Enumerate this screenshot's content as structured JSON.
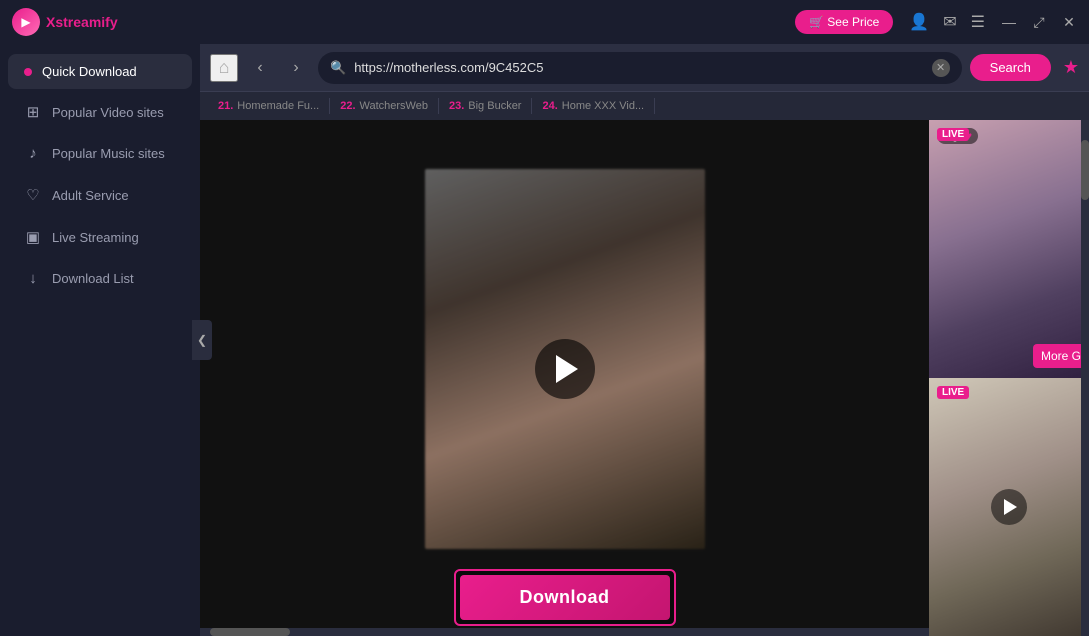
{
  "app": {
    "name_prefix": "X",
    "name_suffix": "streamify",
    "logo_glyph": "▶"
  },
  "titlebar": {
    "see_price_label": "🛒 See Price",
    "icons": [
      "👤",
      "✉",
      "☰"
    ],
    "win_min": "—",
    "win_restore": "⤢",
    "win_close": "✕"
  },
  "sidebar": {
    "items": [
      {
        "id": "quick-download",
        "label": "Quick Download",
        "active": true
      },
      {
        "id": "popular-video",
        "label": "Popular Video sites",
        "active": false
      },
      {
        "id": "popular-music",
        "label": "Popular Music sites",
        "active": false
      },
      {
        "id": "adult-service",
        "label": "Adult Service",
        "active": false
      },
      {
        "id": "live-streaming",
        "label": "Live Streaming",
        "active": false
      },
      {
        "id": "download-list",
        "label": "Download List",
        "active": false
      }
    ],
    "collapse_icon": "❮"
  },
  "browser": {
    "url": "https://motherless.com/9C452C5",
    "search_label": "Search",
    "bookmark_icon": "★"
  },
  "site_tabs": [
    {
      "num": "21.",
      "label": "Homemade Fu..."
    },
    {
      "num": "22.",
      "label": "WatchersWeb"
    },
    {
      "num": "23.",
      "label": "Big Bucker"
    },
    {
      "num": "24.",
      "label": "Home XXX Vid..."
    }
  ],
  "video": {
    "download_label": "Download"
  },
  "live_cards": [
    {
      "id": "card-1",
      "user": "fog-",
      "live_badge": "LIVE",
      "more_label": "More G"
    },
    {
      "id": "card-2",
      "live_badge": "LIVE"
    }
  ]
}
